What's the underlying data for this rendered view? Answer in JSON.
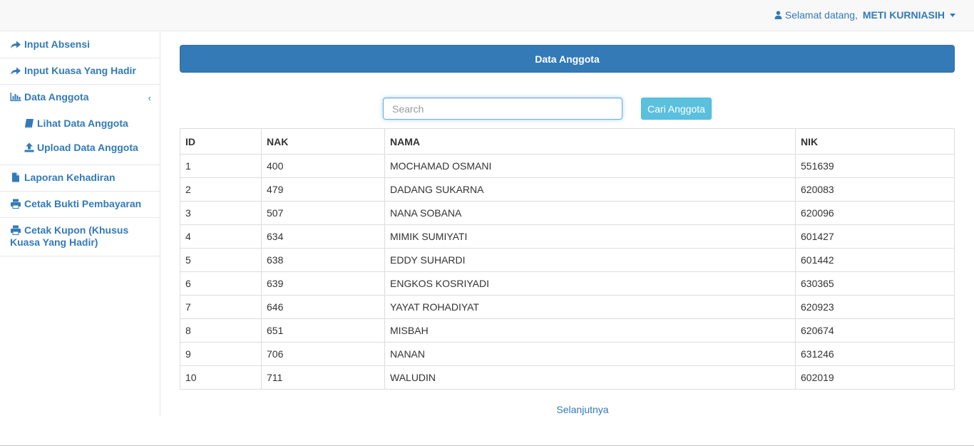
{
  "header": {
    "greeting": "Selamat datang,",
    "username": "METI KURNIASIH"
  },
  "sidebar": {
    "items": [
      {
        "label": "Input Absensi",
        "icon": "share-arrow-icon"
      },
      {
        "label": "Input Kuasa Yang Hadir",
        "icon": "share-arrow-icon"
      },
      {
        "label": "Data Anggota",
        "icon": "bar-chart-icon"
      },
      {
        "label": "Laporan Kehadiran",
        "icon": "file-icon"
      },
      {
        "label": "Cetak Bukti Pembayaran",
        "icon": "print-icon"
      },
      {
        "label": "Cetak Kupon (Khusus Kuasa Yang Hadir)",
        "icon": "print-icon"
      }
    ],
    "subitems": [
      {
        "label": "Lihat Data Anggota",
        "icon": "book-icon"
      },
      {
        "label": "Upload Data Anggota",
        "icon": "upload-icon"
      }
    ]
  },
  "main": {
    "title": "Data Anggota",
    "search": {
      "placeholder": "Search",
      "value": ""
    },
    "search_button": "Cari Anggota",
    "table": {
      "headers": [
        "ID",
        "NAK",
        "NAMA",
        "NIK"
      ],
      "rows": [
        [
          "1",
          "400",
          "MOCHAMAD OSMANI",
          "551639"
        ],
        [
          "2",
          "479",
          "DADANG SUKARNA",
          "620083"
        ],
        [
          "3",
          "507",
          "NANA SOBANA",
          "620096"
        ],
        [
          "4",
          "634",
          "MIMIK SUMIYATI",
          "601427"
        ],
        [
          "5",
          "638",
          "EDDY SUHARDI",
          "601442"
        ],
        [
          "6",
          "639",
          "ENGKOS KOSRIYADI",
          "630365"
        ],
        [
          "7",
          "646",
          "YAYAT ROHADIYAT",
          "620923"
        ],
        [
          "8",
          "651",
          "MISBAH",
          "620674"
        ],
        [
          "9",
          "706",
          "NANAN",
          "631246"
        ],
        [
          "10",
          "711",
          "WALUDIN",
          "602019"
        ]
      ]
    },
    "next_label": "Selanjutnya"
  },
  "colors": {
    "primary": "#337ab7",
    "info": "#5bc0de",
    "topbar": "#f8f8f8",
    "border": "#e7e7e7"
  }
}
